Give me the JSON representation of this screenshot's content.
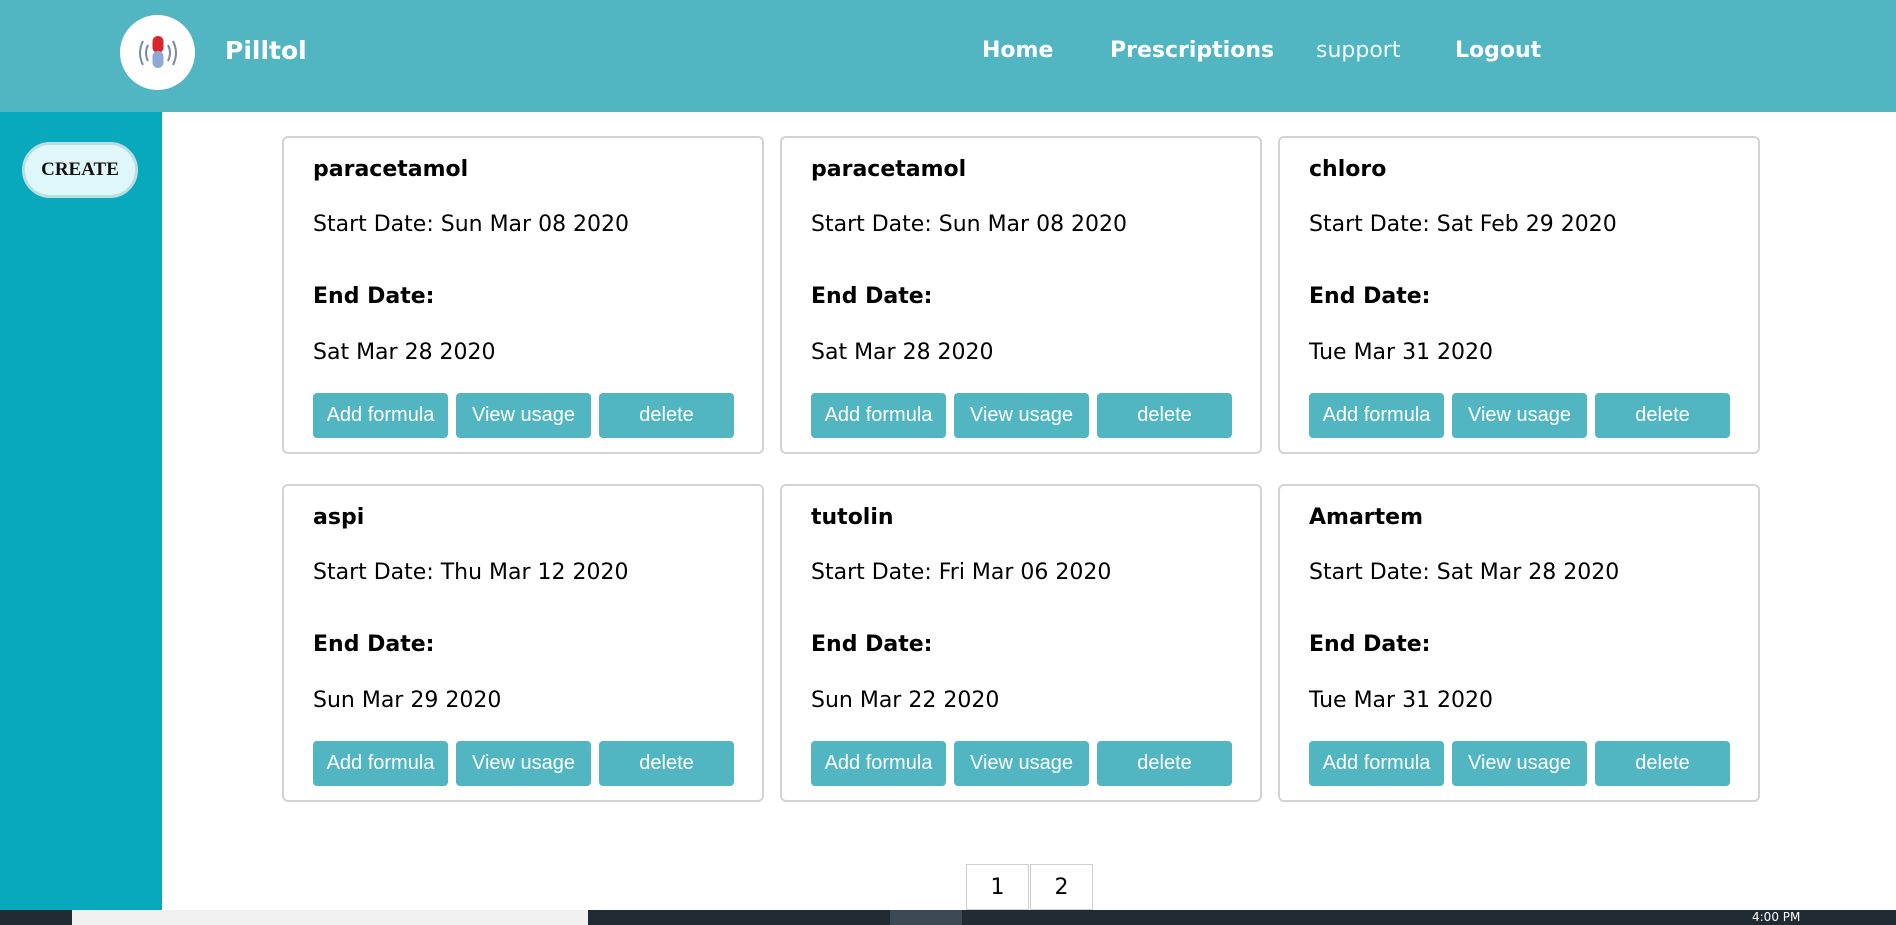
{
  "app": {
    "brand": "Pilltol",
    "logo_icon": "pill-sound-icon",
    "colors": {
      "header": "#52b6c2",
      "sidebar": "#08a8bd",
      "button": "#52b6c2"
    }
  },
  "nav": {
    "items": [
      "Home",
      "Prescriptions",
      "support",
      "Logout"
    ]
  },
  "sidebar": {
    "create_label": "CREATE"
  },
  "cards": [
    {
      "name": "paracetamol",
      "start": "Start Date: Sun Mar 08 2020",
      "end_label": "End Date:",
      "end": "Sat Mar 28 2020"
    },
    {
      "name": "paracetamol",
      "start": "Start Date: Sun Mar 08 2020",
      "end_label": "End Date:",
      "end": "Sat Mar 28 2020"
    },
    {
      "name": "chloro",
      "start": "Start Date: Sat Feb 29 2020",
      "end_label": "End Date:",
      "end": "Tue Mar 31 2020"
    },
    {
      "name": "aspi",
      "start": "Start Date: Thu Mar 12 2020",
      "end_label": "End Date:",
      "end": "Sun Mar 29 2020"
    },
    {
      "name": "tutolin",
      "start": "Start Date: Fri Mar 06 2020",
      "end_label": "End Date:",
      "end": "Sun Mar 22 2020"
    },
    {
      "name": "Amartem",
      "start": "Start Date: Sat Mar 28 2020",
      "end_label": "End Date:",
      "end": "Tue Mar 31 2020"
    }
  ],
  "card_buttons": {
    "add_formula": "Add formula",
    "view_usage": "View usage",
    "delete": "delete"
  },
  "pagination": {
    "pages": [
      "1",
      "2"
    ]
  },
  "taskbar": {
    "time": "4:00 PM"
  }
}
